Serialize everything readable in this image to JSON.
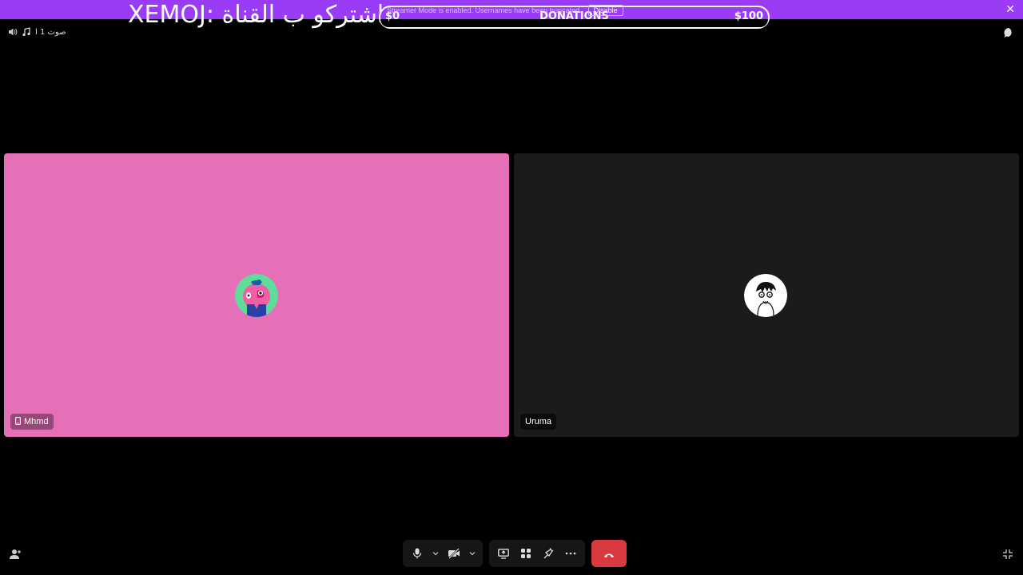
{
  "banner": {
    "overlay_text": "XEMOJ: اشتركو ب القناة",
    "close_label": "✕",
    "color": "#9a3bf5"
  },
  "donation": {
    "title": "DONATIONS",
    "min_label": "$0",
    "max_label": "$100",
    "progress_fraction": 0
  },
  "streamer_mode": {
    "message": "Streamer Mode is enabled. Usernames have been truncated.",
    "disable_label": "Disable"
  },
  "channel": {
    "name": "صوت 1 ا",
    "icons": [
      "speaker-icon",
      "music-note-icon"
    ]
  },
  "participants": [
    {
      "name": "Mhmd",
      "tile_color": "#e670b7",
      "device_icon": "mobile-phone-icon"
    },
    {
      "name": "Uruma",
      "tile_color": "#1b1b1b"
    }
  ],
  "controls": {
    "mute_icon": "microphone-icon",
    "camera_icon": "camera-off-icon",
    "share_icon": "screen-share-icon",
    "activities_icon": "activities-icon",
    "soundboard_icon": "soundboard-icon",
    "more_icon": "more-dots-icon",
    "hangup_icon": "phone-hangup-icon",
    "hangup_color": "#d83a42"
  }
}
